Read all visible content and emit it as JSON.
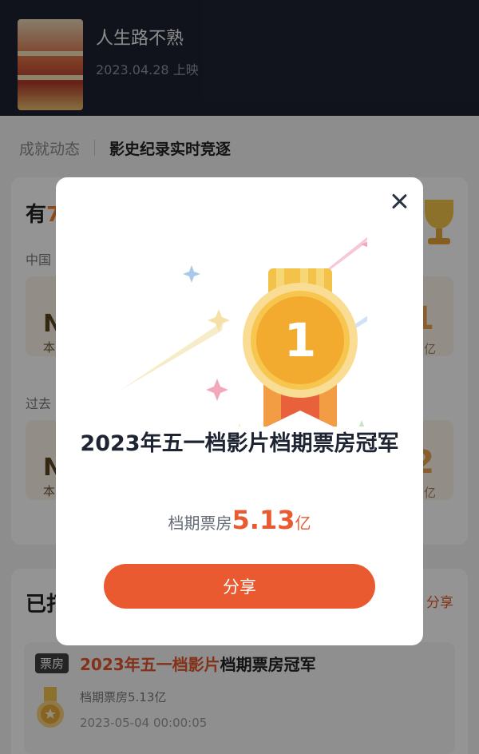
{
  "movie": {
    "title": "人生路不熟",
    "release": "2023.04.28 上映"
  },
  "tabs": [
    {
      "label": "成就动态"
    },
    {
      "label": "影史纪录实时竞逐"
    }
  ],
  "card1": {
    "title_prefix": "有",
    "title_highlight": "7",
    "section1": "中国",
    "section2": "过去",
    "box1": {
      "no": "NO",
      "sub": "本",
      "num": "1",
      "unit": "亿"
    },
    "box2": {
      "no": "NO",
      "sub": "本",
      "num": "2",
      "unit": "亿"
    }
  },
  "card2": {
    "title": "已打",
    "share": "分享",
    "record": {
      "tag": "票房",
      "title_highlight": "2023年五一档影片",
      "title_rest": "档期票房冠军",
      "line1": "档期票房5.13亿",
      "line2": "2023-05-04 00:00:05"
    }
  },
  "modal": {
    "medal_number": "1",
    "title": "2023年五一档影片档期票房冠军",
    "value_label": "档期票房",
    "value_number": "5.13",
    "value_unit": "亿",
    "share_button": "分享"
  },
  "colors": {
    "accent": "#e95a30",
    "header_bg": "#1d2230",
    "medal_gold": "#f4b63f",
    "ribbon_orange": "#e8613b"
  }
}
